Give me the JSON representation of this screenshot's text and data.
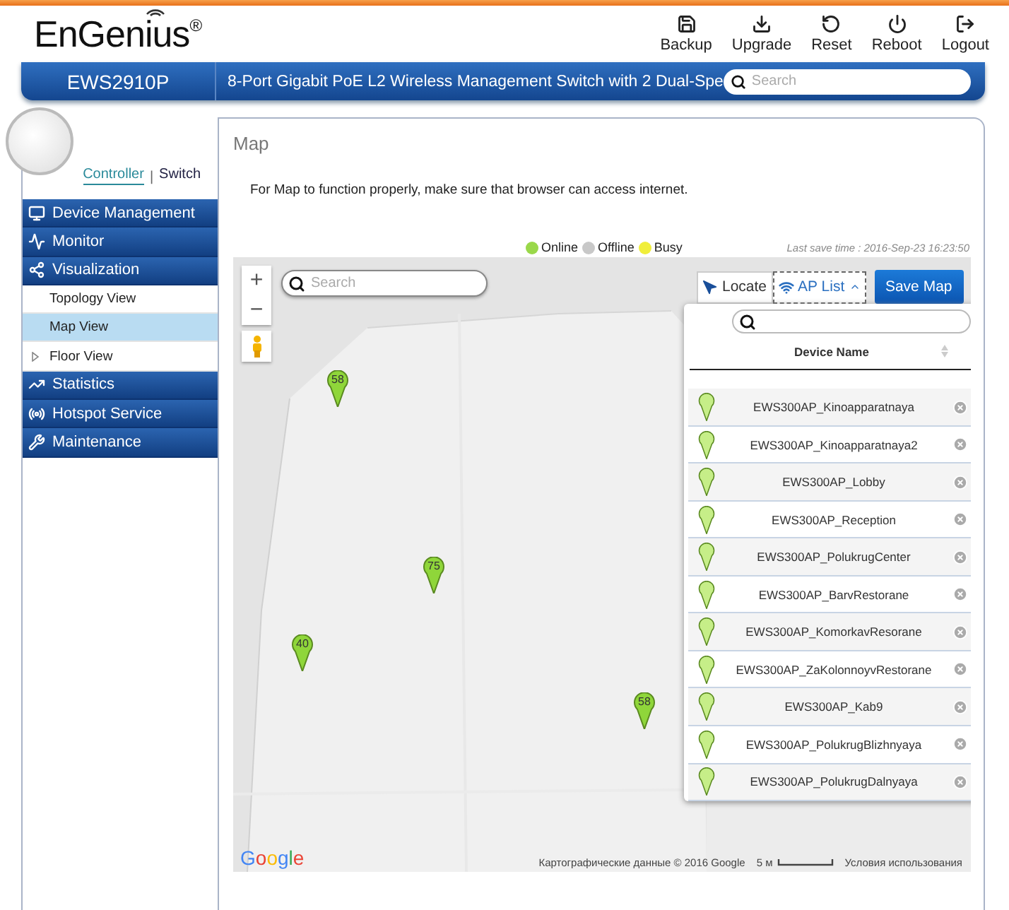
{
  "header": {
    "logo": "EnGenius$^{®}$",
    "actions": [
      {
        "label": "Backup"
      },
      {
        "label": "Upgrade"
      },
      {
        "label": "Reset"
      },
      {
        "label": "Reboot"
      },
      {
        "label": "Logout"
      }
    ]
  },
  "title_bar": {
    "model": "EWS2910P",
    "title": "8-Port Gigabit PoE L2 Wireless Management Switch with 2 Dual-Spe",
    "search": {
      "placeholder": "Search"
    }
  },
  "mode_tabs": [
    {
      "label": "Controller",
      "selected": true
    },
    {
      "label": "Switch",
      "selected": false
    }
  ],
  "mode_separator": "|",
  "sidebar": {
    "items": [
      {
        "label": "Device Management",
        "kind": "section"
      },
      {
        "label": "Monitor",
        "kind": "section"
      },
      {
        "label": "Visualization",
        "kind": "section"
      },
      {
        "label": "Topology View",
        "kind": "sub",
        "selected": false
      },
      {
        "label": "Map View",
        "kind": "sub",
        "selected": true
      },
      {
        "label": "Floor View",
        "kind": "sub",
        "selected": false,
        "expanded": false
      },
      {
        "label": "Statistics",
        "kind": "section"
      },
      {
        "label": "Hotspot Service",
        "kind": "section"
      },
      {
        "label": "Maintenance",
        "kind": "section"
      }
    ]
  },
  "page_title": "Map",
  "notice": "For Map to function properly, make sure that browser can access internet.",
  "legend": [
    {
      "label": "Online",
      "color": "#9ad84a"
    },
    {
      "label": "Offline",
      "color": "#c8c8c8"
    },
    {
      "label": "Busy",
      "color": "#f0ee3a"
    }
  ],
  "last_save": "Last save time : 2016-Sep-23 16:23:50",
  "map": {
    "zoom_in": "+",
    "zoom_out": "−",
    "search": {
      "placeholder": "Search"
    },
    "markers": [
      {
        "label": "58"
      },
      {
        "label": "75"
      },
      {
        "label": "40"
      },
      {
        "label": "58"
      }
    ],
    "locate": "Locate",
    "ap_list": {
      "label": "AP List",
      "expanded": true
    },
    "save": "Save Map",
    "attribution": "Google",
    "map_data": "Картографические данные © 2016 Google",
    "scale": "5 м",
    "terms": "Условия использования"
  },
  "ap_panel": {
    "column": "Device Name",
    "devices": [
      {
        "name": "EWS300AP_Kinoapparatnaya"
      },
      {
        "name": "EWS300AP_Kinoapparatnaya2"
      },
      {
        "name": "EWS300AP_Lobby"
      },
      {
        "name": "EWS300AP_Reception"
      },
      {
        "name": "EWS300AP_PolukrugCenter"
      },
      {
        "name": "EWS300AP_BarvRestorane"
      },
      {
        "name": "EWS300AP_KomorkavResorane"
      },
      {
        "name": "EWS300AP_ZaKolonnoyvRestorane"
      },
      {
        "name": "EWS300AP_Kab9"
      },
      {
        "name": "EWS300AP_PolukrugBlizhnyaya"
      },
      {
        "name": "EWS300AP_PolukrugDalnyaya"
      }
    ]
  }
}
